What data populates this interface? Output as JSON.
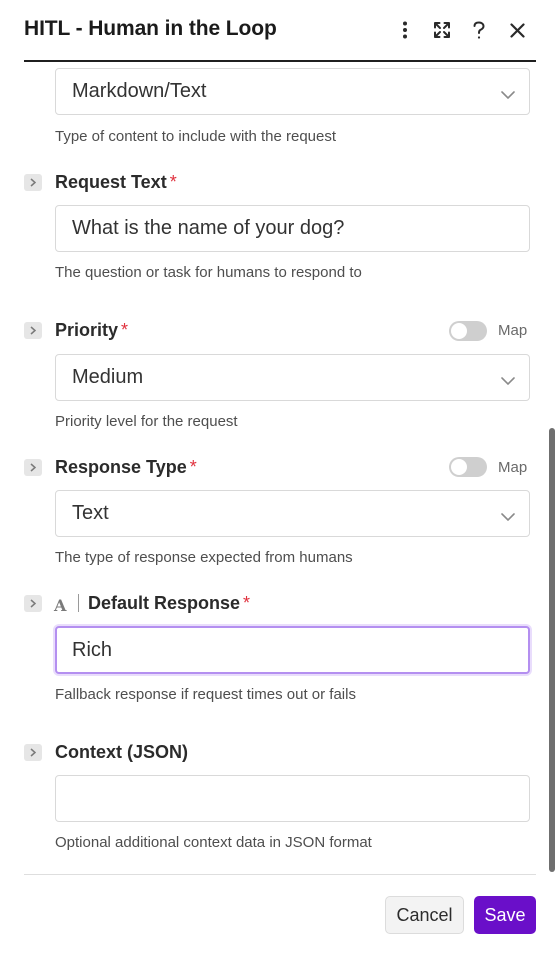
{
  "header": {
    "title": "HITL - Human in the Loop",
    "icons": [
      "more-vertical-icon",
      "expand-icon",
      "help-icon",
      "close-icon"
    ]
  },
  "content_type": {
    "value": "Markdown/Text",
    "help": "Type of content to include with the request"
  },
  "request_text": {
    "label": "Request Text",
    "required": "*",
    "value": "What is the name of your dog?",
    "help": "The question or task for humans to respond to"
  },
  "priority": {
    "label": "Priority",
    "required": "*",
    "map_label": "Map",
    "value": "Medium",
    "help": "Priority level for the request"
  },
  "response_type": {
    "label": "Response Type",
    "required": "*",
    "map_label": "Map",
    "value": "Text",
    "help": "The type of response expected from humans"
  },
  "default_response": {
    "type_glyph": "A",
    "label": "Default Response",
    "required": "*",
    "value": "Rich",
    "help": "Fallback response if request times out or fails"
  },
  "context": {
    "label": "Context (JSON)",
    "value": "",
    "help": "Optional additional context data in JSON format"
  },
  "footer": {
    "cancel_label": "Cancel",
    "save_label": "Save"
  },
  "colors": {
    "accent": "#6a0fc9",
    "required": "#e0303d",
    "focus_ring": "#b48ff0"
  }
}
